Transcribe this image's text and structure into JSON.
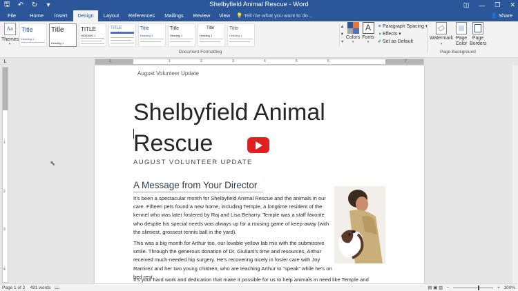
{
  "window": {
    "title": "Shelbyfield Animal Rescue - Word",
    "controls": [
      "◫",
      "—",
      "❐",
      "✕"
    ]
  },
  "quick_access": {
    "save": "🖫",
    "undo": "↶",
    "redo": "↻",
    "customize": "▾"
  },
  "tabs": [
    {
      "label": "File"
    },
    {
      "label": "Home"
    },
    {
      "label": "Insert"
    },
    {
      "label": "Design"
    },
    {
      "label": "Layout"
    },
    {
      "label": "References"
    },
    {
      "label": "Mailings"
    },
    {
      "label": "Review"
    },
    {
      "label": "View"
    }
  ],
  "active_tab": "Design",
  "tell_me": "Tell me what you want to do...",
  "share_label": "Share",
  "ribbon": {
    "themes_label": "Themes",
    "themes_icon_text": "Aa",
    "style_thumbs": [
      "Title",
      "Title",
      "TITLE",
      "TITLE",
      "Title",
      "Title",
      "Title",
      "Title"
    ],
    "style_sub": [
      "Heading 1",
      "Heading 1",
      "HEADING 1",
      "",
      "Heading 1",
      "Heading 1",
      "Heading 1",
      "Heading 1"
    ],
    "document_formatting_label": "Document Formatting",
    "colors_label": "Colors",
    "fonts_label": "Fonts",
    "fonts_icon_text": "A",
    "paragraph_spacing": "Paragraph Spacing",
    "effects": "Effects",
    "set_as_default": "Set as Default",
    "watermark": "Watermark",
    "page_color": "Page\nColor",
    "page_borders": "Page\nBorders",
    "page_background_label": "Page Background",
    "theme_colors": [
      "#2b579a",
      "#e8763b",
      "#a5a5a5",
      "#4a72b8"
    ]
  },
  "ruler": {
    "h_numbers": [
      "1",
      "1",
      "2",
      "3",
      "4",
      "5",
      "6",
      "7"
    ],
    "v_numbers": [
      "1",
      "2",
      "3",
      "4"
    ]
  },
  "document": {
    "header": "August Volunteer Update",
    "title": "Shelbyfield Animal Rescue",
    "subtitle": "AUGUST VOLUNTEER UPDATE",
    "heading": "A Message from Your Director",
    "paragraphs": [
      "It’s been a spectacular month for Shelbyfield Animal Rescue and the animals in our care. Fifteen pets found a new home, including Temple, a longtime resident of the kennel who was later fostered by Raj and Lisa Beharry. Temple was a staff favorite who despite his special needs was always up for a rousing game of keep-away (with the slimiest, grossest tennis ball in the yard).",
      "This was a big month for Arthur too, our lovable yellow lab mix with the submissive smile. Through the generous donation of Dr. Giuliani’s time and resources, Arthur received much-needed hip surgery. He’s recovering nicely in foster care with Joy Ramirez and her two young children, who are teaching Arthur to “speak” while he’s on bed rest.",
      "It’s your hard work and dedication that make it possible for us to help animals in need like Temple and"
    ]
  },
  "status": {
    "page": "Page 1 of 2",
    "words": "491 words",
    "zoom": "100%"
  },
  "colors": {
    "brand": "#2b579a",
    "video_play": "#e02020"
  }
}
